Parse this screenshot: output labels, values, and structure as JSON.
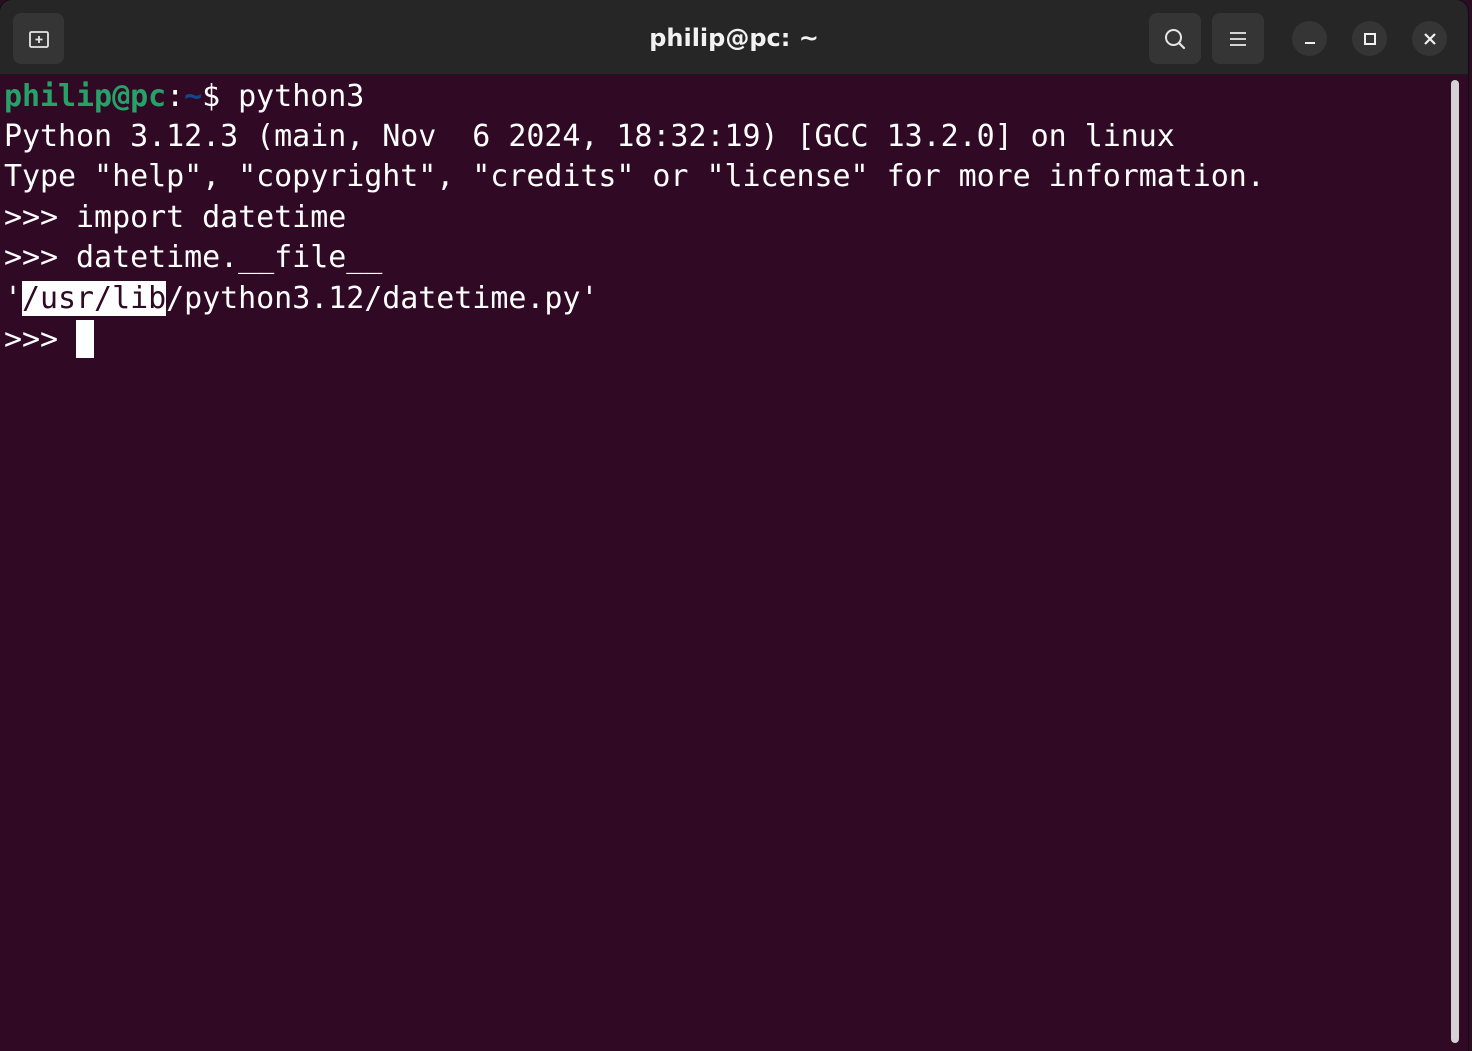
{
  "window": {
    "title": "philip@pc: ~"
  },
  "icons": {
    "new_tab": "new-tab-icon",
    "search": "search-icon",
    "menu": "hamburger-menu-icon",
    "minimize": "minimize-icon",
    "maximize": "maximize-icon",
    "close": "close-icon"
  },
  "terminal": {
    "line1": {
      "user_host": "philip@pc",
      "colon": ":",
      "path": "~",
      "dollar_cmd": "$ python3"
    },
    "line2": "Python 3.12.3 (main, Nov  6 2024, 18:32:19) [GCC 13.2.0] on linux",
    "line3": "Type \"help\", \"copyright\", \"credits\" or \"license\" for more information.",
    "line4": ">>> import datetime",
    "line5": ">>> datetime.__file__",
    "line6": {
      "quote_open": "'",
      "selected": "/usr/lib",
      "rest": "/python3.12/datetime.py'"
    },
    "line7": ">>> "
  },
  "colors": {
    "background": "#300a24",
    "titlebar": "#262626",
    "prompt_user": "#26a269",
    "prompt_path": "#12488b",
    "text": "#ffffff"
  }
}
